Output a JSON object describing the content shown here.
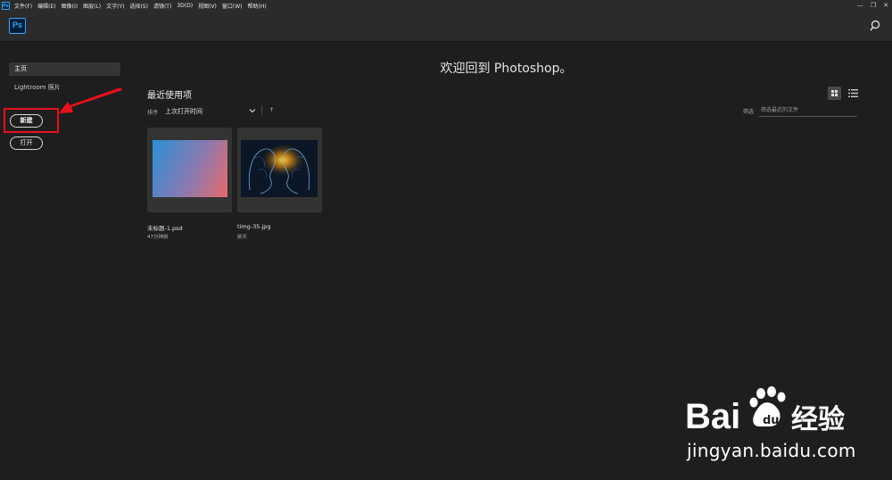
{
  "menubar": {
    "app_icon": "Ps",
    "items": [
      "文件(F)",
      "编辑(E)",
      "图像(I)",
      "图层(L)",
      "文字(Y)",
      "选择(S)",
      "滤镜(T)",
      "3D(D)",
      "视图(V)",
      "窗口(W)",
      "帮助(H)"
    ],
    "window_controls": [
      "minimize-icon",
      "restore-icon",
      "close-icon"
    ]
  },
  "header": {
    "logo": "Ps",
    "search_icon": "search-icon"
  },
  "sidebar": {
    "items": [
      {
        "label": "主页"
      },
      {
        "label": "Lightroom 照片"
      }
    ],
    "new_button": "新建",
    "open_button": "打开"
  },
  "main": {
    "welcome": "欢迎回到 Photoshop。",
    "recent_title": "最近使用项",
    "sort": {
      "label": "排序",
      "value": "上次打开时间",
      "direction": "↑"
    },
    "filter": {
      "label": "筛选",
      "placeholder": "筛选最近的文件"
    },
    "files": [
      {
        "name": "未标题-1.psd",
        "time": "47分钟前"
      },
      {
        "name": "timg-35.jpg",
        "time": "前天"
      }
    ]
  },
  "watermark": {
    "brand": "Bai",
    "brand_cn": "经验",
    "url": "jingyan.baidu.com"
  },
  "colors": {
    "background": "#1e1e1e",
    "accent": "#31a8ff",
    "highlight": "#e8101a"
  }
}
